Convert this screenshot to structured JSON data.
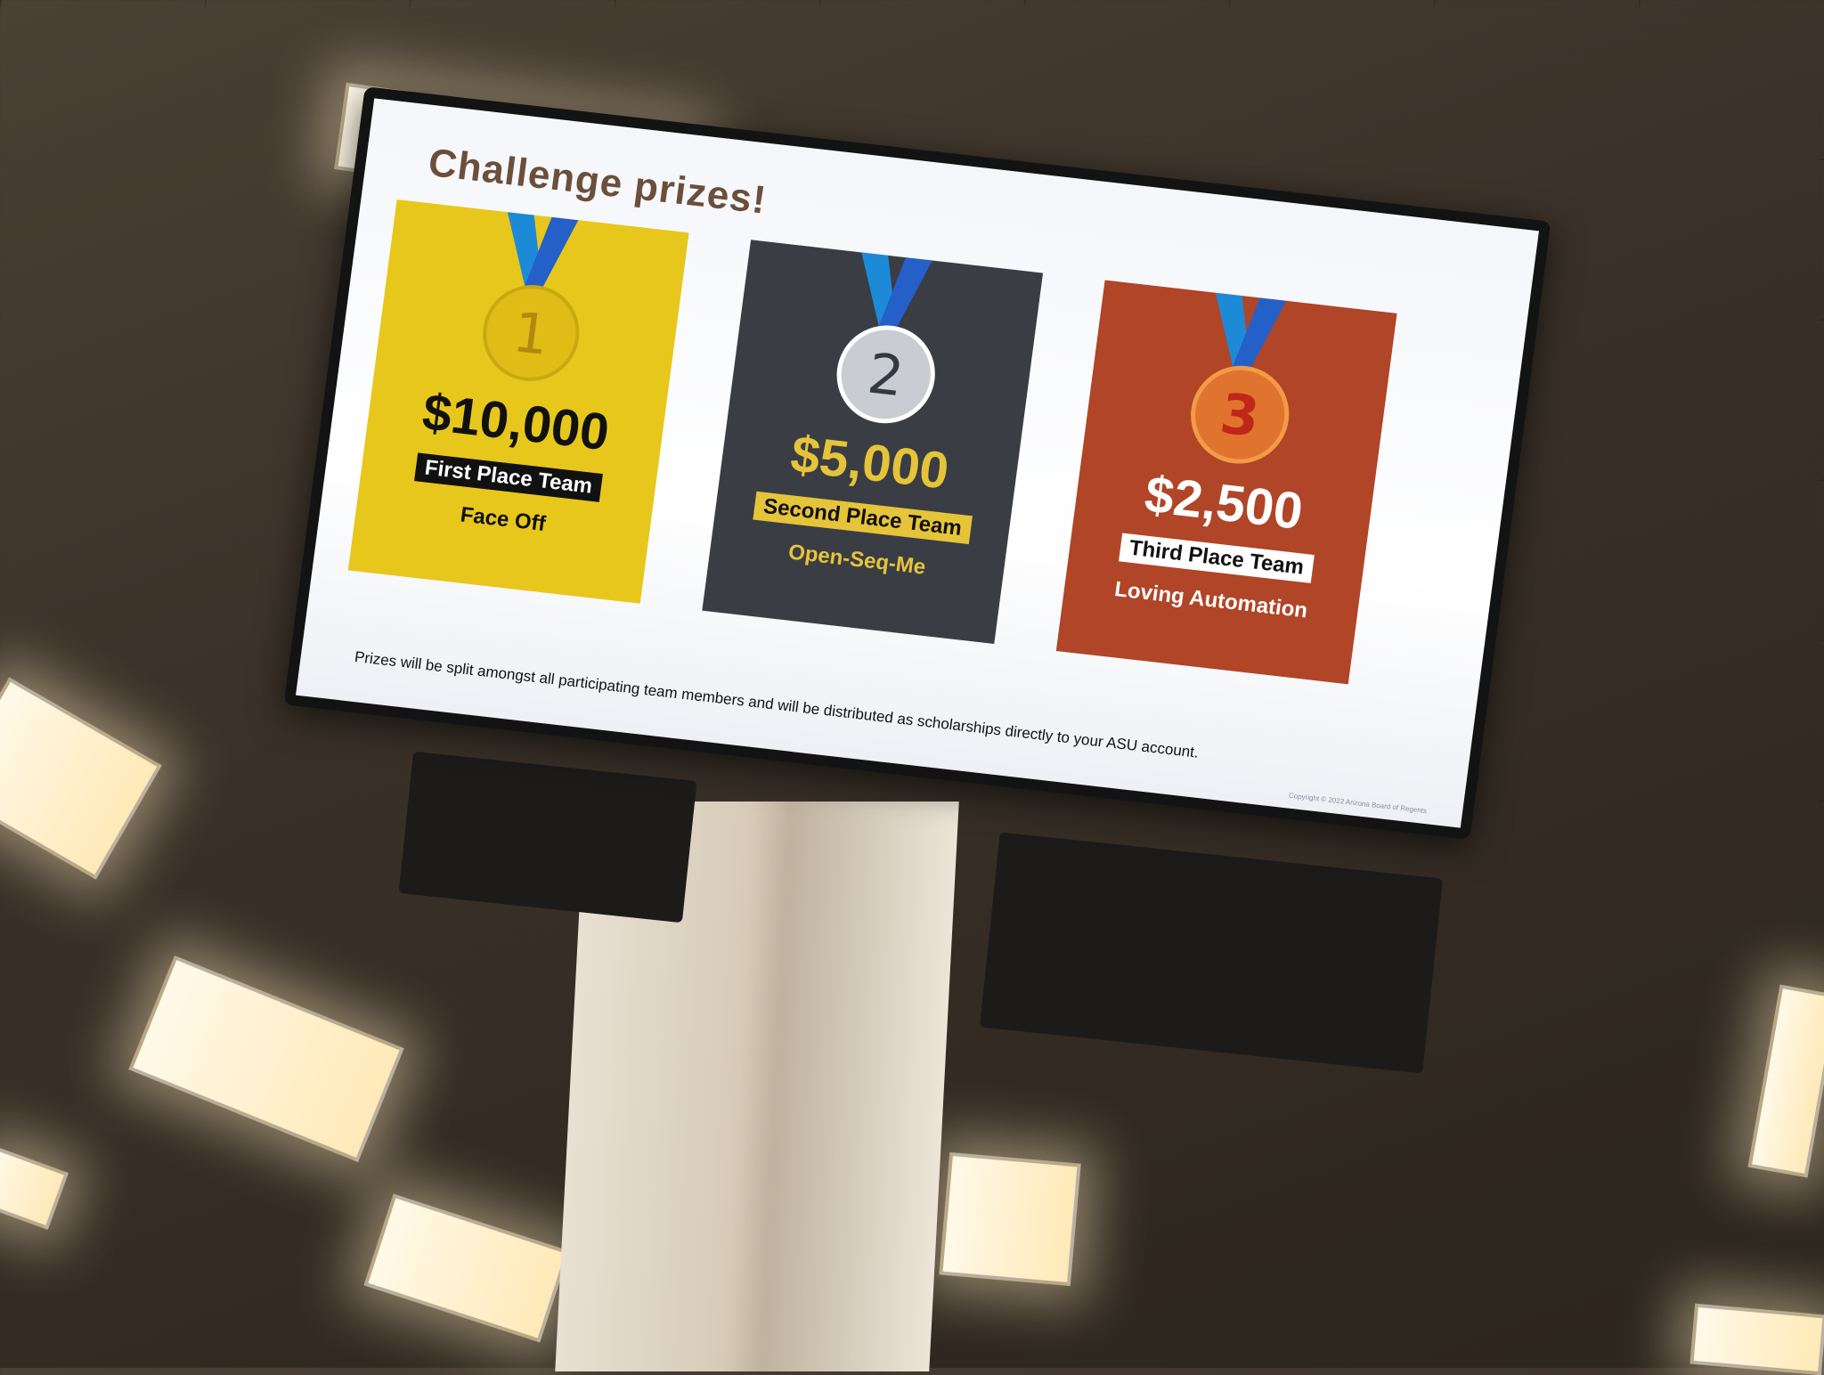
{
  "slide": {
    "title": "Challenge prizes!",
    "footnote": "Prizes will be split amongst all participating team members and will be distributed as scholarships directly to your ASU account.",
    "copyright": "Copyright © 2022 Arizona Board of Regents"
  },
  "prizes": [
    {
      "medal": "1",
      "amount": "$10,000",
      "place": "First Place Team",
      "team": "Face Off",
      "color": "#e7c71c"
    },
    {
      "medal": "2",
      "amount": "$5,000",
      "place": "Second Place Team",
      "team": "Open-Seq-Me",
      "color": "#3a3d44"
    },
    {
      "medal": "3",
      "amount": "$2,500",
      "place": "Third Place Team",
      "team": "Loving Automation",
      "color": "#b04527"
    }
  ],
  "icons": [
    "ribbon-icon",
    "medal-icon"
  ]
}
